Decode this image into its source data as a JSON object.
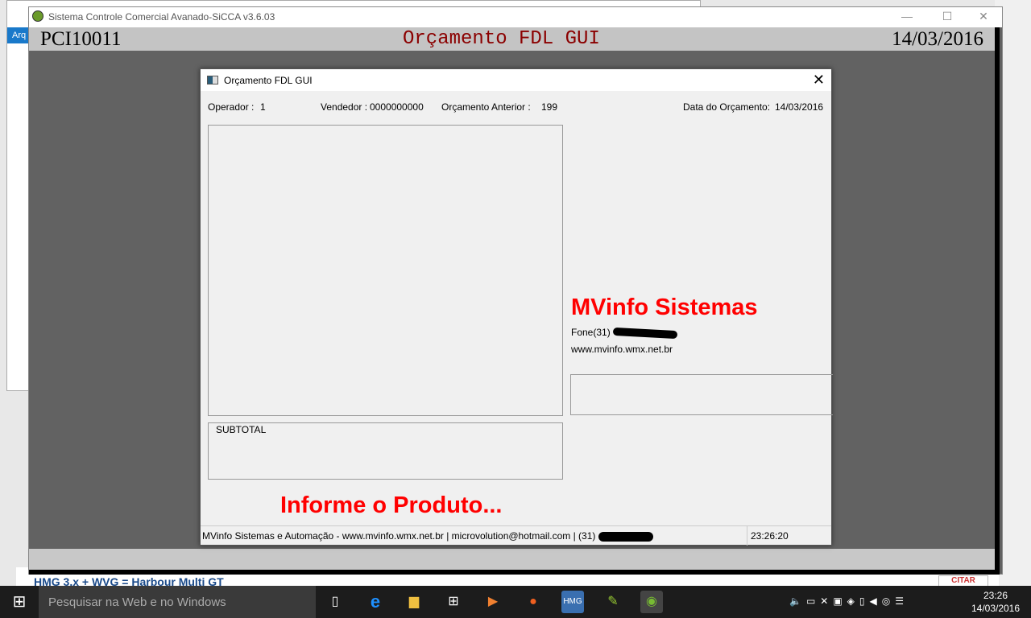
{
  "background": {
    "menu_stub": "Arq",
    "forum_title": "HMG 3.x + WVG = Harbour Multi GT",
    "cite_button": "CITAR"
  },
  "app": {
    "title": "Sistema Controle Comercial Avanado-SiCCA v3.6.03",
    "program_code": "PCI10011",
    "screen_title": "Orçamento FDL GUI",
    "date": "14/03/2016"
  },
  "dialog": {
    "title": "Orçamento FDL GUI",
    "operator_label": "Operador :",
    "operator_value": "1",
    "seller_label": "Vendedor :",
    "seller_value": "0000000000",
    "previous_label": "Orçamento Anterior :",
    "previous_value": "199",
    "date_label": "Data do Orçamento:",
    "date_value": "14/03/2016",
    "subtotal_label": "SUBTOTAL",
    "brand": "MVinfo Sistemas",
    "phone": "Fone(31)",
    "website": "www.mvinfo.wmx.net.br",
    "prompt": "Informe o Produto...",
    "status_text": "MVinfo Sistemas e Automação - www.mvinfo.wmx.net.br | microvolution@hotmail.com | (31)",
    "status_time": "23:26:20"
  },
  "taskbar": {
    "search_placeholder": "Pesquisar na Web e no Windows",
    "time": "23:26",
    "date": "14/03/2016"
  }
}
